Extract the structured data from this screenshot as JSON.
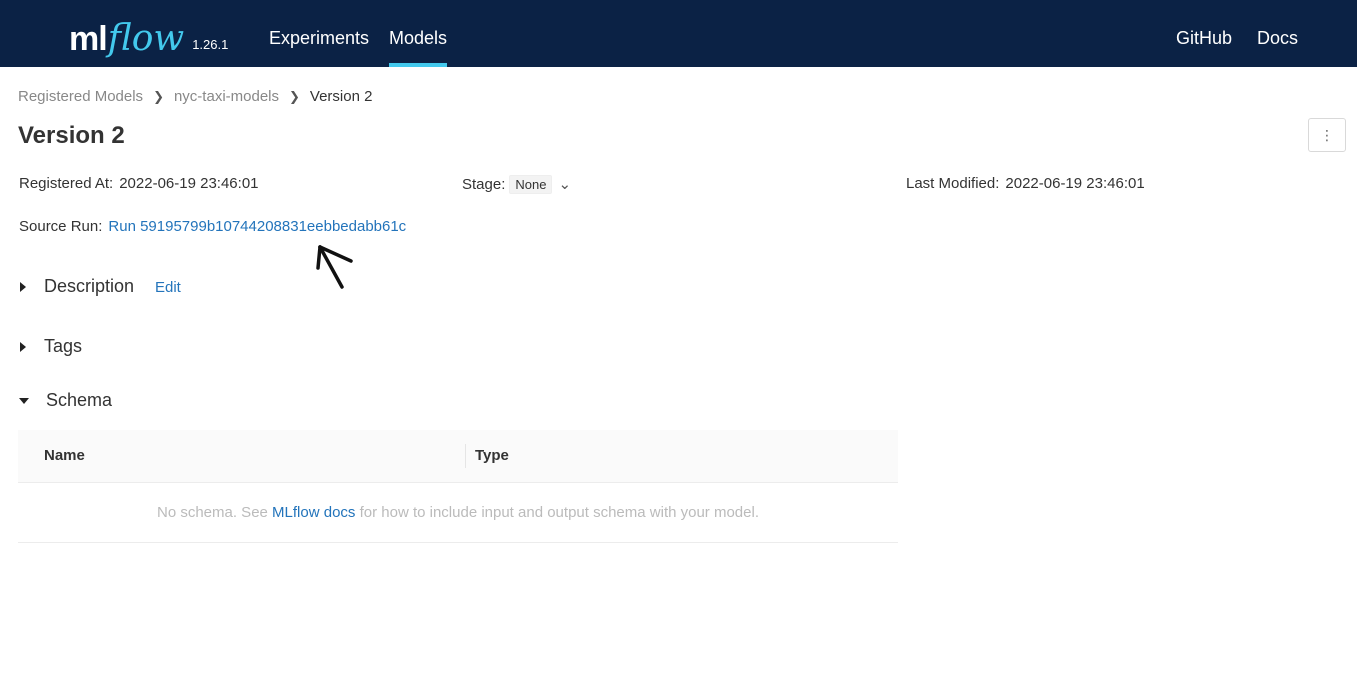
{
  "header": {
    "logo_ml": "ml",
    "logo_flow": "flow",
    "version": "1.26.1",
    "nav_left": [
      "Experiments",
      "Models"
    ],
    "nav_right": [
      "GitHub",
      "Docs"
    ],
    "active_nav": "Models"
  },
  "breadcrumb": {
    "items": [
      "Registered Models",
      "nyc-taxi-models",
      "Version 2"
    ]
  },
  "page": {
    "title": "Version 2",
    "menu_icon": "more-vertical-icon"
  },
  "meta": {
    "registered_label": "Registered At:",
    "registered_value": "2022-06-19 23:46:01",
    "stage_label": "Stage:",
    "stage_value": "None",
    "modified_label": "Last Modified:",
    "modified_value": "2022-06-19 23:46:01",
    "source_label": "Source Run:",
    "source_value": "Run 59195799b10744208831eebbedabb61c"
  },
  "sections": {
    "description": "Description",
    "edit": "Edit",
    "tags": "Tags",
    "schema": "Schema"
  },
  "schema_table": {
    "columns": [
      "Name",
      "Type"
    ],
    "empty_prefix": "No schema. See ",
    "empty_link": "MLflow docs",
    "empty_suffix": " for how to include input and output schema with your model."
  },
  "colors": {
    "header_bg": "#0b2245",
    "accent": "#43c9ed",
    "link": "#2374bb"
  }
}
